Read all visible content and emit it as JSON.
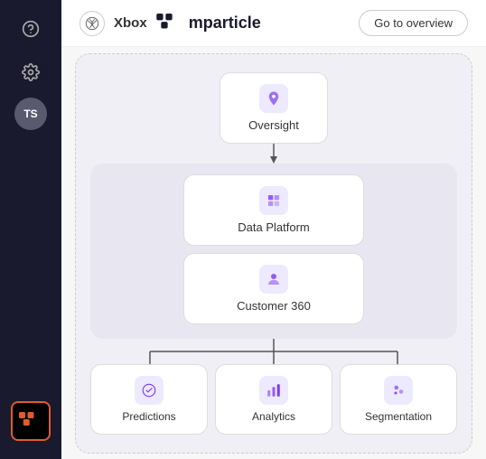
{
  "header": {
    "app_name": "Xbox",
    "logo_name": "mparticle",
    "overview_button": "Go to overview"
  },
  "sidebar": {
    "avatar_initials": "TS",
    "items": [
      {
        "label": "Help",
        "icon": "help-icon"
      },
      {
        "label": "Settings",
        "icon": "settings-icon"
      }
    ]
  },
  "diagram": {
    "nodes": {
      "oversight": "Oversight",
      "data_platform": "Data Platform",
      "customer_360": "Customer 360",
      "predictions": "Predictions",
      "analytics": "Analytics",
      "segmentation": "Segmentation"
    }
  }
}
